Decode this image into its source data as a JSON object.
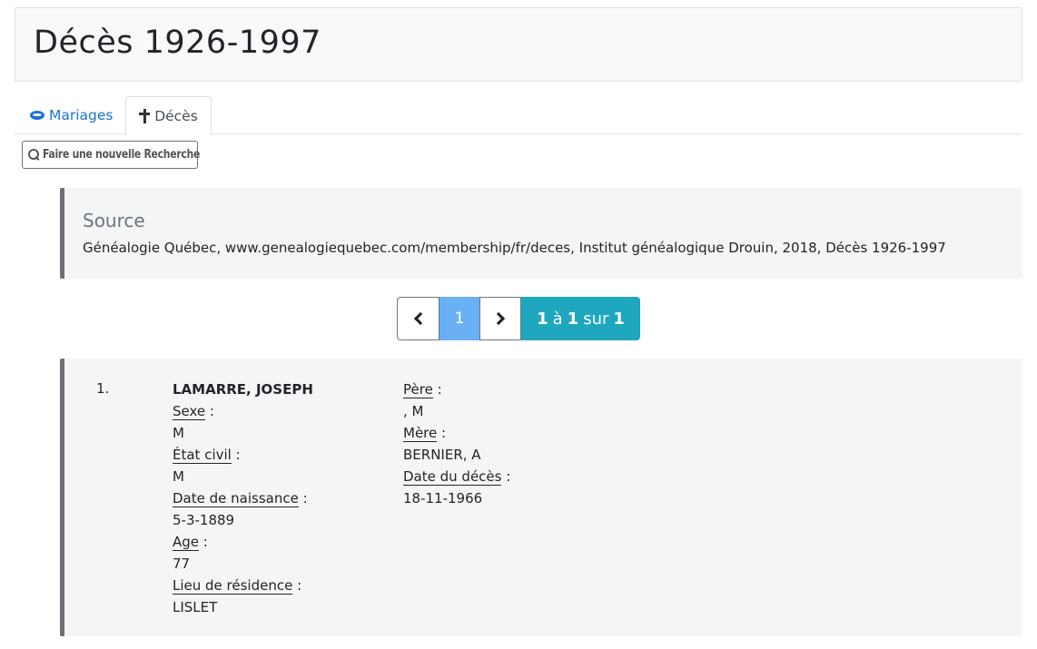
{
  "header": {
    "title": "Décès 1926-1997"
  },
  "tabs": [
    {
      "label": "Mariages",
      "icon": "rings-icon",
      "active": false
    },
    {
      "label": "Décès",
      "icon": "cross-icon",
      "active": true
    }
  ],
  "toolbar": {
    "new_search_label": "Faire une nouvelle Recherche"
  },
  "source": {
    "title": "Source",
    "text": "Généalogie Québec, www.genealogiequebec.com/membership/fr/deces, Institut généalogique Drouin, 2018, Décès 1926-1997"
  },
  "pagination": {
    "current_page": "1",
    "range_start": "1",
    "range_word": "à",
    "range_end": "1",
    "of_word": "sur",
    "total": "1"
  },
  "record": {
    "index": "1.",
    "name": "LAMARRE, JOSEPH",
    "fields_left": [
      {
        "label": "Sexe",
        "value": "M"
      },
      {
        "label": "État civil",
        "value": "M"
      },
      {
        "label": "Date de naissance",
        "value": "5-3-1889"
      },
      {
        "label": "Age",
        "value": "77"
      },
      {
        "label": "Lieu de résidence",
        "value": "LISLET"
      }
    ],
    "fields_right": [
      {
        "label": "Père",
        "value": ", M"
      },
      {
        "label": "Mère",
        "value": "BERNIER, A"
      },
      {
        "label": "Date du décès",
        "value": "18-11-1966"
      }
    ]
  },
  "colors": {
    "link": "#1a73d0",
    "pager_active": "#6ab0f5",
    "pager_count": "#1ea7bf",
    "panel_bg": "#f4f5f7"
  }
}
